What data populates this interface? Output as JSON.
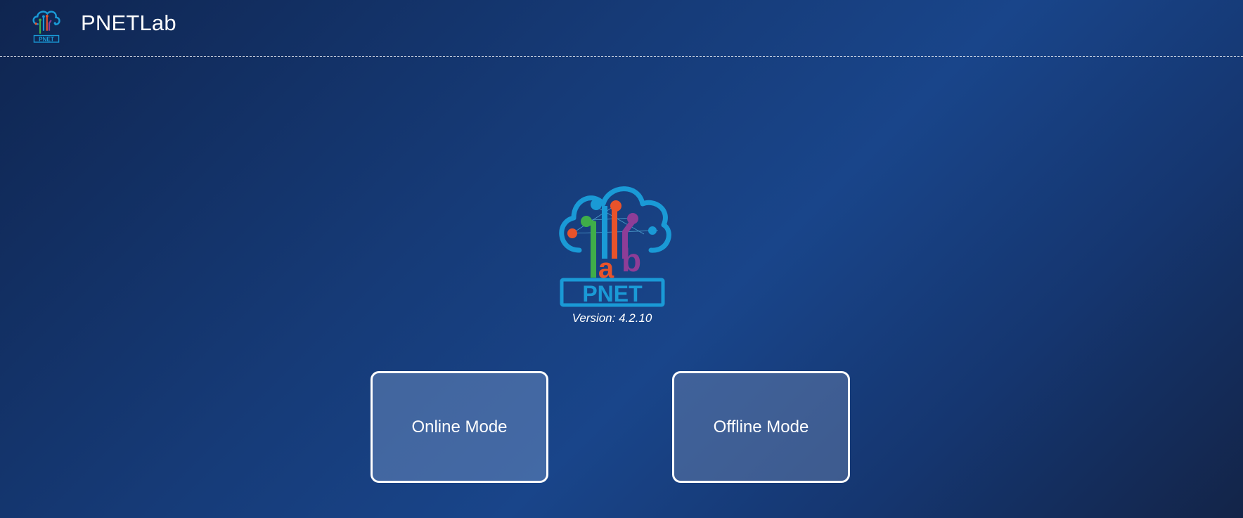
{
  "header": {
    "app_title": "PNETLab",
    "logo_icon": "pnetlab-logo-icon"
  },
  "main": {
    "logo_icon": "pnetlab-cloud-logo-icon",
    "logo_text": "PNET",
    "version_text": "Version: 4.2.10"
  },
  "modes": {
    "online_label": "Online Mode",
    "offline_label": "Offline Mode"
  },
  "colors": {
    "background_start": "#0f2550",
    "background_mid": "#19458a",
    "logo_blue": "#1a9ad6",
    "logo_green": "#3fae49",
    "logo_orange": "#e8532b",
    "logo_purple": "#8e3d97"
  }
}
